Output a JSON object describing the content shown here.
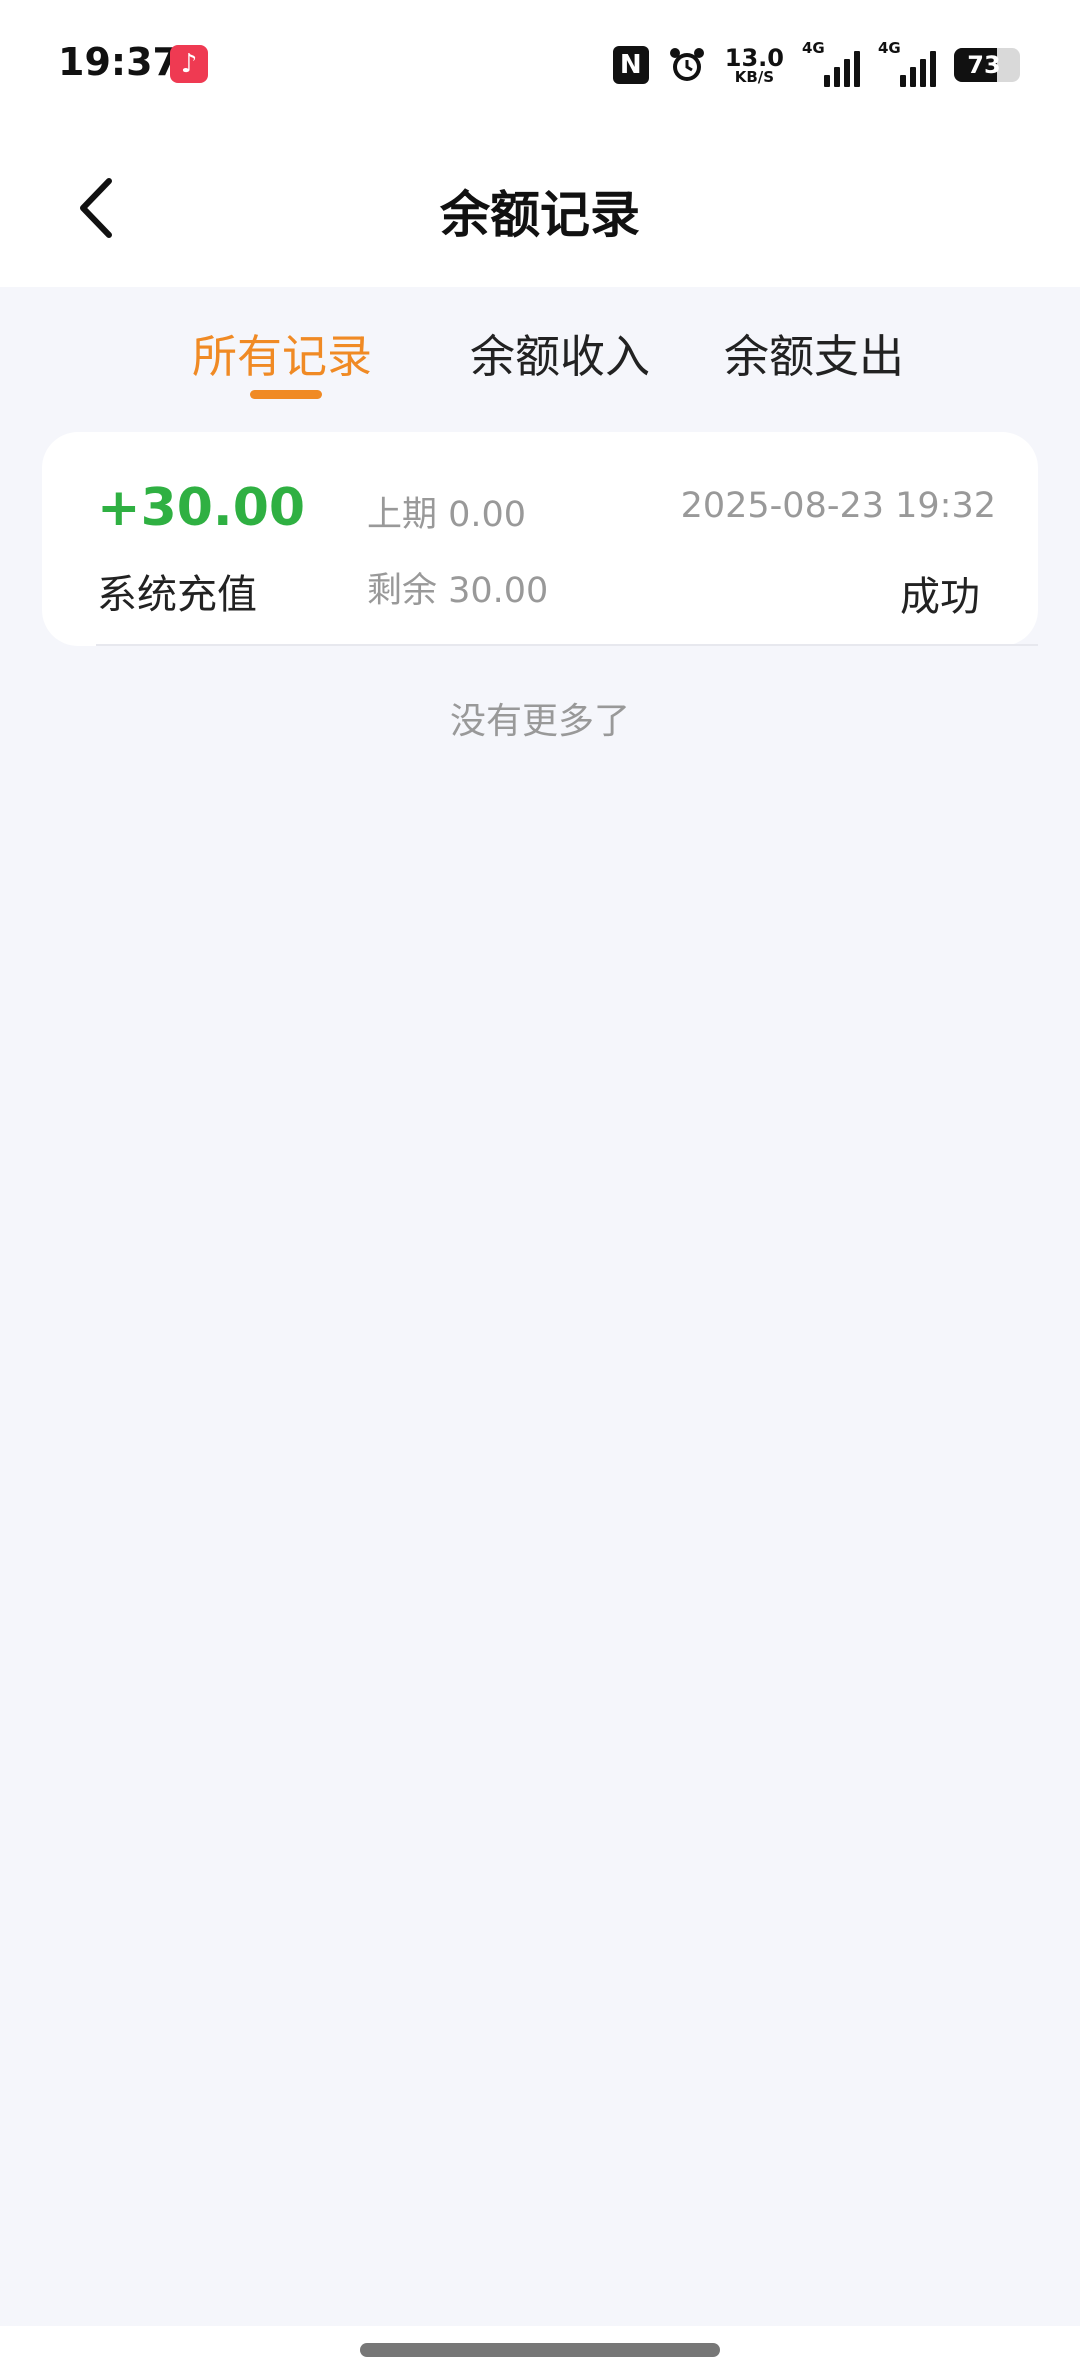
{
  "status_bar": {
    "time": "19:37",
    "music_icon": "music-note-icon",
    "nfc_label": "N",
    "net_speed_value": "13.0",
    "net_speed_unit": "KB/S",
    "signal1_label": "4G",
    "signal2_label": "4G",
    "battery_level": "73"
  },
  "nav": {
    "back_icon": "chevron-left-icon",
    "title": "余额记录"
  },
  "tabs": [
    {
      "label": "所有记录",
      "active": true
    },
    {
      "label": "余额收入",
      "active": false
    },
    {
      "label": "余额支出",
      "active": false
    }
  ],
  "records": [
    {
      "amount": "+30.00",
      "type": "系统充值",
      "previous": "上期 0.00",
      "remaining": "剩余 30.00",
      "datetime": "2025-08-23 19:32",
      "status": "成功"
    }
  ],
  "footer_text": "没有更多了",
  "colors": {
    "accent": "#f08a24",
    "income": "#2fb042",
    "muted": "#999999",
    "background": "#f5f6fb"
  }
}
